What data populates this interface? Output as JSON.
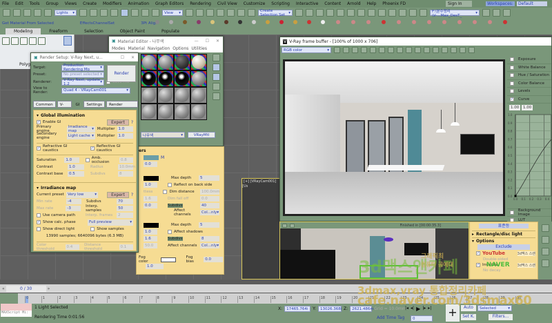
{
  "menu": [
    "File",
    "Edit",
    "Tools",
    "Group",
    "Views",
    "Create",
    "Modifiers",
    "Animation",
    "Graph Editors",
    "Rendering",
    "Civil View",
    "Customize",
    "Scripting",
    "Interactive",
    "Content",
    "Arnold",
    "Help",
    "Phoenix FD"
  ],
  "account": {
    "sign_in": "Sign In",
    "workspaces_label": "Workspaces:",
    "workspace": "Default"
  },
  "toolbar": {
    "selection_filter": "Lights",
    "ref_coord": "View",
    "selection_set": "Create Selection Set",
    "project_path": "F:\\분수정리\\V-...Max_DesT_"
  },
  "row3": {
    "get_material": "Get Material From Selected",
    "effects_channel": "EffectsChannelSet",
    "align": "3Pt Align"
  },
  "ribbon": {
    "tabs": [
      "Modeling",
      "Freeform",
      "Selection",
      "Object Paint",
      "Populate"
    ],
    "active": "Modeling",
    "panel_label": "Polyg"
  },
  "material_editor": {
    "title": "Material Editor - 나무색",
    "menu": [
      "Modes",
      "Material",
      "Navigation",
      "Options",
      "Utilities"
    ],
    "material_name": "나무색",
    "material_type": "VRayMtl"
  },
  "render_setup": {
    "title": "Render Setup: V-Ray Next, u...",
    "target_label": "Target:",
    "target": "Production Rendering Mo",
    "preset_label": "Preset:",
    "preset": "No preset selected",
    "renderer_label": "Renderer:",
    "renderer": "V-Ray Next, update 1.2",
    "save_file": "Save File",
    "view_label": "View to Render:",
    "view": "Quad 4 - VRayCam001",
    "render_button": "Render",
    "tabs": [
      "Common",
      "V-Ray",
      "GI",
      "Settings",
      "Render Elements"
    ],
    "active_tab": "GI",
    "gi": {
      "title": "Global illumination",
      "enable": "Enable GI",
      "expert": "Expert",
      "help": "?",
      "primary_label": "Primary engine",
      "primary": "Irradiance map",
      "mult1_label": "Multiplier",
      "mult1": "1.0",
      "secondary_label": "Secondary engine",
      "secondary": "Light cache",
      "mult2_label": "Multiplier",
      "mult2": "1.0",
      "refractive": "Refractive GI caustics",
      "reflective": "Reflective GI caustics",
      "saturation_label": "Saturation",
      "saturation": "1.0",
      "amb_label": "Amb. occlusion",
      "amb": "0.8",
      "contrast_label": "Contrast",
      "contrast": "1.0",
      "radius_label": "Radius",
      "radius": "10.0mm",
      "contrast_base_label": "Contrast base",
      "contrast_base": "0.5",
      "subdivs_label": "Subdivs",
      "subdivs": "8"
    },
    "irr": {
      "title": "Irradiance map",
      "preset_label": "Current preset",
      "preset": "Very low",
      "expert": "Expert",
      "help": "?",
      "min_rate_label": "Min rate",
      "min_rate": "-4",
      "subdivs_label": "Subdivs",
      "subdivs": "70",
      "max_rate_label": "Max rate",
      "max_rate": "-3",
      "interp_label": "Interp. samples",
      "interp": "50",
      "camera_path": "Use camera path",
      "interp_frames_label": "Interp. frames",
      "interp_frames": "2",
      "show_calc": "Show calc. phase",
      "preview": "Full preview",
      "show_direct": "Show direct light",
      "show_samples": "Show samples",
      "info": "13990 samples; 6640096 bytes (6.3 MB)",
      "color_thr_label": "Color threshold",
      "color_thr": "0.4",
      "dist_thr_label": "Distance threshold",
      "dist_thr": "0.1"
    }
  },
  "mat_params": {
    "title": "ers",
    "m_label": "M",
    "v1": "0.0",
    "refl": {
      "v1": "1.0",
      "label_a": "ttess",
      "v2": "1.6",
      "v3": "0.0",
      "max_depth_label": "Max depth",
      "max_depth": "5",
      "reflect_back": "Reflect on back side",
      "dim_label": "Dim distance",
      "dim": "100.0mm",
      "dim_falloff_label": "Dim fall off",
      "dim_falloff": "0.0",
      "subdivs_label": "Subdivs",
      "subdivs": "40",
      "affect_label": "Affect channels",
      "affect": "Col...nly"
    },
    "refr": {
      "v1": "1.0",
      "v2": "1.6",
      "v3": "50.0",
      "max_depth_label": "Max depth",
      "max_depth": "5",
      "affect_shadows": "Affect shadows",
      "subdivs_label": "Subdivs",
      "subdivs": "8",
      "affect_label": "Affect channels",
      "affect": "Col...nly"
    },
    "fog": {
      "color_label": "Fog color",
      "bias_label": "Fog bias",
      "bias": "0.0",
      "mult": "1.0"
    }
  },
  "vfb": {
    "title": "V-Ray frame buffer - [100% of 1000 x 706]",
    "channel": "RGB color",
    "status": "Finished in [00:00:35.3]",
    "corrections": [
      {
        "label": "Exposure",
        "on": false
      },
      {
        "label": "White Balance",
        "on": false
      },
      {
        "label": "Hue / Saturation",
        "on": false
      },
      {
        "label": "Color Balance",
        "on": false
      },
      {
        "label": "Levels",
        "on": false
      },
      {
        "label": "Curve",
        "on": true
      }
    ],
    "curve_in": "1.00",
    "curve_out": "1.00",
    "curve_ticks": [
      "0.0",
      "0.1",
      "0.2",
      "0.3",
      "0.4",
      "0.5",
      "0.6",
      "0.7",
      "0.8",
      "0.9",
      "1.0"
    ],
    "background": "Background Image",
    "lut": "LUT"
  },
  "viewport": {
    "label": "[+] [VRayCam001] [Us"
  },
  "light_panel": {
    "header": "표준등",
    "rect": "Rectangle/disc light",
    "options": "Options",
    "exclude": "Exclude",
    "double_sided": "Double-sided",
    "invisible": "Invisible",
    "no_decay": "No decay",
    "wm1": "YouTube",
    "wm2": "3d맥스 스랜",
    "wm3": "NAVER",
    "wm4": "3d맥스 스랜"
  },
  "timeline": {
    "frame": "0 / 30",
    "ticks": [
      "0",
      "1",
      "2",
      "3",
      "4",
      "5",
      "6",
      "7",
      "8",
      "9",
      "10",
      "11",
      "12",
      "13",
      "14",
      "15",
      "16",
      "17",
      "18",
      "19",
      "20",
      "21",
      "22",
      "23",
      "24",
      "25",
      "26",
      "27",
      "28",
      "29",
      "30"
    ]
  },
  "status": {
    "script": "MAXScript Mi:",
    "selected": "1 Light Selected",
    "render_time": "Rendering Time  0:01:56",
    "x_label": "X:",
    "x": "17465.764i",
    "y_label": "Y:",
    "y": "13026.368i",
    "z_label": "Z:",
    "z": "2621.486m",
    "grid": "Grid = 10.0mm",
    "add_time_tag": "Add Time Tag",
    "frame_field": "0",
    "auto": "Auto",
    "set_key": "Set K.",
    "key_mode": "Selected",
    "filters": "Filters..."
  },
  "watermark": {
    "line1": "3dmax,vray 통합정리카페",
    "line2": "cafe.naver.com/3dsmax60",
    "overlay": "3d맥스앤카페",
    "overlay2": "그래픽최",
    "overlay3": "컴퓨터 공예대"
  }
}
